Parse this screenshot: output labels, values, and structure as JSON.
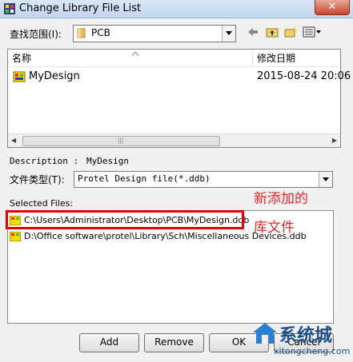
{
  "window": {
    "title": "Change Library File List",
    "close_label": "✕"
  },
  "look_in": {
    "label": "查找范围(I):",
    "value": "PCB"
  },
  "file_list": {
    "headers": {
      "name": "名称",
      "modified": "修改日期"
    },
    "rows": [
      {
        "name": "MyDesign",
        "modified": "2015-08-24 20:06"
      }
    ]
  },
  "description": {
    "label": "Description :",
    "value": "MyDesign"
  },
  "file_type": {
    "label": "文件类型(T):",
    "value": "Protel Design file(*.ddb)"
  },
  "selected_files": {
    "label": "Selected Files:",
    "items": [
      "C:\\Users\\Administrator\\Desktop\\PCB\\MyDesign.ddb",
      "D:\\Office software\\protel\\Library\\Sch\\Miscellaneous Devices.ddb"
    ]
  },
  "annotation": {
    "line1": "新添加的",
    "line2": "库文件"
  },
  "buttons": {
    "add": "Add",
    "remove": "Remove",
    "ok": "OK",
    "cancel": "Cancel"
  },
  "watermark": {
    "name": "系统城",
    "url": "xitongcheng.com"
  },
  "colors": {
    "highlight": "#e00000",
    "annotation": "#e32a2a"
  }
}
